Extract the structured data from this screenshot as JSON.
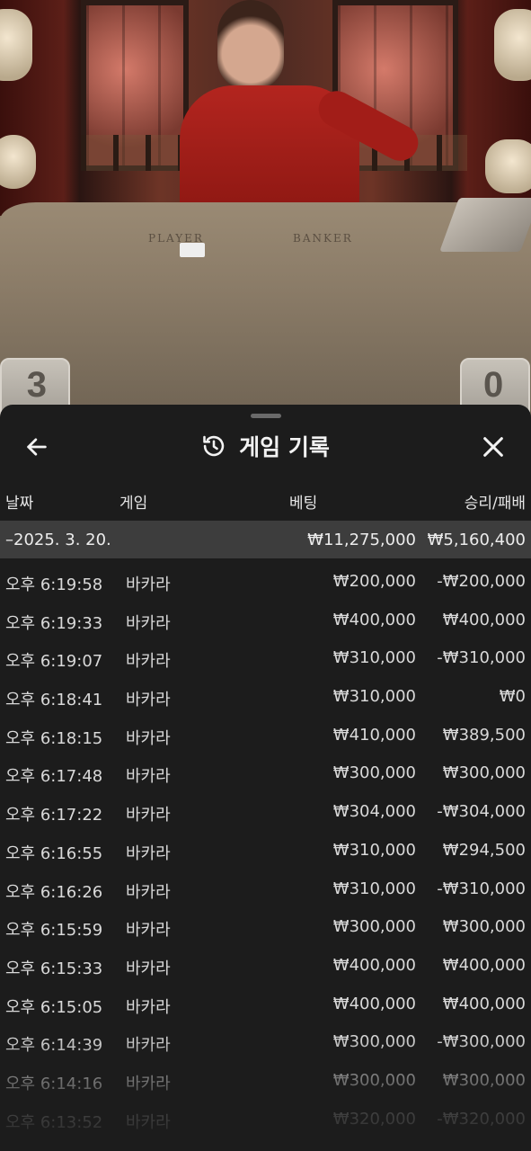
{
  "video": {
    "felt_player": "PLAYER",
    "felt_banker": "BANKER",
    "score_left": "3",
    "score_right": "0"
  },
  "sheet": {
    "title": "게임 기록",
    "icons": {
      "back": "arrow-left-icon",
      "history": "history-clock-icon",
      "close": "close-icon"
    }
  },
  "columns": {
    "date": "날짜",
    "game": "게임",
    "bet": "베팅",
    "result": "승리/패배"
  },
  "summary": {
    "date": "–2025. 3. 20.",
    "bet": "₩11,275,000",
    "result": "₩5,160,400"
  },
  "rows": [
    {
      "time": "오후 6:19:58",
      "game": "바카라",
      "bet": "₩200,000",
      "result": "-₩200,000"
    },
    {
      "time": "오후 6:19:33",
      "game": "바카라",
      "bet": "₩400,000",
      "result": "₩400,000"
    },
    {
      "time": "오후 6:19:07",
      "game": "바카라",
      "bet": "₩310,000",
      "result": "-₩310,000"
    },
    {
      "time": "오후 6:18:41",
      "game": "바카라",
      "bet": "₩310,000",
      "result": "₩0"
    },
    {
      "time": "오후 6:18:15",
      "game": "바카라",
      "bet": "₩410,000",
      "result": "₩389,500"
    },
    {
      "time": "오후 6:17:48",
      "game": "바카라",
      "bet": "₩300,000",
      "result": "₩300,000"
    },
    {
      "time": "오후 6:17:22",
      "game": "바카라",
      "bet": "₩304,000",
      "result": "-₩304,000"
    },
    {
      "time": "오후 6:16:55",
      "game": "바카라",
      "bet": "₩310,000",
      "result": "₩294,500"
    },
    {
      "time": "오후 6:16:26",
      "game": "바카라",
      "bet": "₩310,000",
      "result": "-₩310,000"
    },
    {
      "time": "오후 6:15:59",
      "game": "바카라",
      "bet": "₩300,000",
      "result": "₩300,000"
    },
    {
      "time": "오후 6:15:33",
      "game": "바카라",
      "bet": "₩400,000",
      "result": "₩400,000"
    },
    {
      "time": "오후 6:15:05",
      "game": "바카라",
      "bet": "₩400,000",
      "result": "₩400,000"
    },
    {
      "time": "오후 6:14:39",
      "game": "바카라",
      "bet": "₩300,000",
      "result": "-₩300,000"
    },
    {
      "time": "오후 6:14:16",
      "game": "바카라",
      "bet": "₩300,000",
      "result": "₩300,000"
    },
    {
      "time": "오후 6:13:52",
      "game": "바카라",
      "bet": "₩320,000",
      "result": "-₩320,000"
    }
  ]
}
